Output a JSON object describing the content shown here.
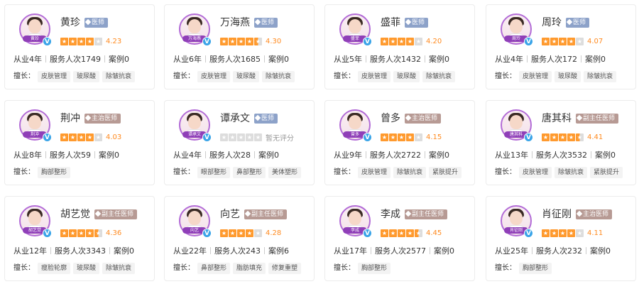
{
  "labels": {
    "years_prefix": "从业",
    "served_prefix": "服务人次",
    "cases_prefix": "案例",
    "spec_label": "擅长："
  },
  "colors": {
    "star": "#ff9a2e",
    "score": "#ff8a1f",
    "avatar_ring": "#b26bd6",
    "verified": "#3aa4e8"
  },
  "doctors": [
    {
      "name": "黄珍",
      "avatar_text": "黄珍",
      "title": "医师",
      "title_kind": "doc",
      "rating": 4.23,
      "score": "4.23",
      "years": "4年",
      "served": "1749",
      "cases": "0",
      "specialties": [
        "皮肤管理",
        "玻尿酸",
        "除皱抗衰"
      ]
    },
    {
      "name": "万海燕",
      "avatar_text": "万海燕",
      "title": "医师",
      "title_kind": "doc",
      "rating": 4.3,
      "score": "4.30",
      "years": "6年",
      "served": "1685",
      "cases": "0",
      "specialties": [
        "皮肤管理",
        "玻尿酸",
        "除皱抗衰"
      ]
    },
    {
      "name": "盛菲",
      "avatar_text": "盛菲",
      "title": "医师",
      "title_kind": "doc",
      "rating": 4.2,
      "score": "4.20",
      "years": "5年",
      "served": "1432",
      "cases": "0",
      "specialties": [
        "皮肤管理",
        "玻尿酸",
        "除皱抗衰"
      ]
    },
    {
      "name": "周玲",
      "avatar_text": "周玲",
      "title": "医师",
      "title_kind": "doc",
      "rating": 4.07,
      "score": "4.07",
      "years": "4年",
      "served": "172",
      "cases": "0",
      "specialties": [
        "皮肤管理",
        "玻尿酸",
        "除皱抗衰"
      ]
    },
    {
      "name": "荆冲",
      "avatar_text": "荆冲",
      "title": "主治医师",
      "title_kind": "chief",
      "rating": 4.03,
      "score": "4.03",
      "years": "8年",
      "served": "59",
      "cases": "0",
      "specialties": [
        "胸部整形"
      ]
    },
    {
      "name": "谭承文",
      "avatar_text": "谭承文",
      "title": "医师",
      "title_kind": "doc",
      "rating": 0,
      "score": "暂无评分",
      "years": "4年",
      "served": "28",
      "cases": "0",
      "specialties": [
        "眼部整形",
        "鼻部整形",
        "美体塑形"
      ]
    },
    {
      "name": "曾多",
      "avatar_text": "曾多",
      "title": "主治医师",
      "title_kind": "chief",
      "rating": 4.15,
      "score": "4.15",
      "years": "9年",
      "served": "2722",
      "cases": "0",
      "specialties": [
        "皮肤管理",
        "除皱抗衰",
        "紧肤提升"
      ]
    },
    {
      "name": "唐其科",
      "avatar_text": "唐其科",
      "title": "副主任医师",
      "title_kind": "deputy",
      "rating": 4.41,
      "score": "4.41",
      "years": "13年",
      "served": "3532",
      "cases": "0",
      "specialties": [
        "皮肤管理",
        "除皱抗衰",
        "紧肤提升"
      ]
    },
    {
      "name": "胡艺觉",
      "avatar_text": "胡艺觉",
      "title": "副主任医师",
      "title_kind": "deputy",
      "rating": 4.36,
      "score": "4.36",
      "years": "12年",
      "served": "3343",
      "cases": "0",
      "specialties": [
        "瘦脸轮廓",
        "玻尿酸",
        "除皱抗衰"
      ]
    },
    {
      "name": "向艺",
      "avatar_text": "向艺",
      "title": "副主任医师",
      "title_kind": "deputy",
      "rating": 4.28,
      "score": "4.28",
      "years": "22年",
      "served": "243",
      "cases": "6",
      "specialties": [
        "鼻部整形",
        "脂肪填充",
        "修复重塑"
      ]
    },
    {
      "name": "李成",
      "avatar_text": "李成",
      "title": "副主任医师",
      "title_kind": "deputy",
      "rating": 4.45,
      "score": "4.45",
      "years": "17年",
      "served": "2577",
      "cases": "0",
      "specialties": [
        "胸部整形"
      ]
    },
    {
      "name": "肖征刚",
      "avatar_text": "肖征刚",
      "title": "主治医师",
      "title_kind": "chief",
      "rating": 4.11,
      "score": "4.11",
      "years": "25年",
      "served": "232",
      "cases": "0",
      "specialties": [
        "胸部整形"
      ]
    }
  ]
}
